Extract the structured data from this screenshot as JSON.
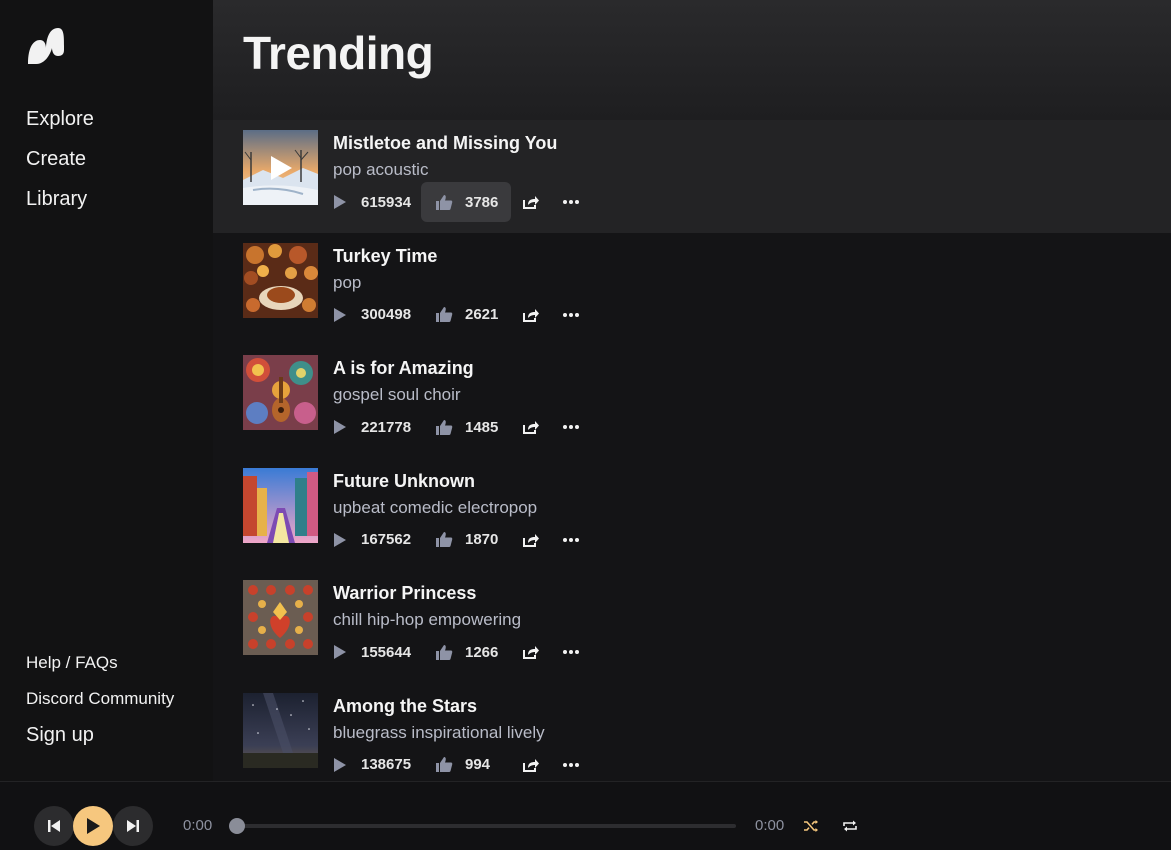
{
  "nav": {
    "items": [
      {
        "label": "Explore"
      },
      {
        "label": "Create"
      },
      {
        "label": "Library"
      }
    ]
  },
  "sidebar_bottom": {
    "help": "Help / FAQs",
    "discord": "Discord Community",
    "signup": "Sign up"
  },
  "page": {
    "title": "Trending"
  },
  "songs": [
    {
      "title": "Mistletoe and Missing You",
      "style": "pop acoustic",
      "plays": "615934",
      "likes": "3786",
      "art": "winter"
    },
    {
      "title": "Turkey Time",
      "style": "pop",
      "plays": "300498",
      "likes": "2621",
      "art": "feast"
    },
    {
      "title": "A is for Amazing",
      "style": "gospel soul choir",
      "plays": "221778",
      "likes": "1485",
      "art": "colorful"
    },
    {
      "title": "Future Unknown",
      "style": "upbeat comedic electropop",
      "plays": "167562",
      "likes": "1870",
      "art": "city"
    },
    {
      "title": "Warrior Princess",
      "style": "chill hip-hop empowering",
      "plays": "155644",
      "likes": "1266",
      "art": "pattern"
    },
    {
      "title": "Among the Stars",
      "style": "bluegrass inspirational lively",
      "plays": "138675",
      "likes": "994",
      "art": "night"
    }
  ],
  "player": {
    "current_time": "0:00",
    "duration": "0:00",
    "progress": 0
  },
  "colors": {
    "accent": "#f6c77e",
    "background": "#141416",
    "sidebar": "#121213",
    "muted_text": "#b9bcc8",
    "icon": "#8e93a6"
  },
  "icons": {
    "play_count": "play-triangle-icon",
    "like": "thumbs-up-icon",
    "share": "share-icon",
    "more": "more-dots-icon"
  }
}
